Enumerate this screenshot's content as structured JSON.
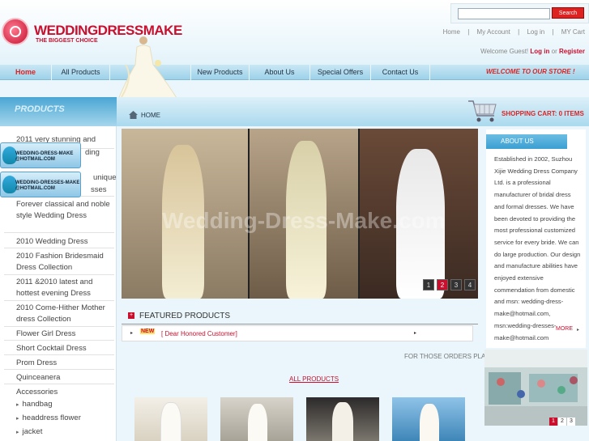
{
  "logo": {
    "name": "WEDDINGDRESSMAKE",
    "tagline": "THE BIGGEST CHOICE"
  },
  "search": {
    "button": "Search",
    "placeholder": ""
  },
  "top_links": [
    "Home",
    "|",
    "My Account",
    "|",
    "Log in",
    "|",
    "MY Cart"
  ],
  "welcome": {
    "prefix": "Welcome Guest!",
    "login": "Log in",
    "or": "or",
    "register": "Register"
  },
  "nav": [
    "Home",
    "All Products",
    "",
    "New Products",
    "About Us",
    "Special Offers",
    "Contact Us"
  ],
  "welcome_store": "WELCOME TO OUR STORE !",
  "sidebar": {
    "title": "PRODUCTS",
    "items": [
      "2011 very stunning and",
      "ding",
      "unique",
      "sses",
      "Forever classical and noble style Wedding Dress",
      "2010 Wedding Dress",
      "2010 Fashion Bridesmaid Dress Collection",
      "2011 &2010 latest and hottest evening Dress",
      "2010 Come-Hither Mother dress Collection",
      "Flower Girl Dress",
      "Short Cocktail Dress",
      "Prom Dress",
      "Quinceanera",
      "Accessories"
    ],
    "sub_items": [
      "handbag",
      "headdress flower",
      "jacket"
    ],
    "msn_badges": [
      "WEDDING-DRESS-MAKE @HOTMAIL.COM",
      "WEDDING-DRESSES-MAKE @HOTMAIL.COM"
    ]
  },
  "breadcrumb": {
    "home": "HOME"
  },
  "cart": {
    "label": "SHOPPING CART: 0 ITEMS"
  },
  "banner": {
    "watermark": "Wedding-Dress-Make.com",
    "pages": [
      "1",
      "2",
      "3",
      "4"
    ],
    "active_page": "2"
  },
  "featured": {
    "title": "FEATURED PRODUCTS",
    "badge": "NEW",
    "ticker": "[ Dear Honored Customer]",
    "orders_text": "FOR THOSE ORDERS PLACE",
    "all_products": "ALL PRODUCTS"
  },
  "about": {
    "title": "ABOUT US",
    "text": "Established in 2002, Suzhou Xijie Wedding Dress Company Ltd. is a professional manufacturer of bridal dress and formal dresses. We have been devoted to providing the most professional customized service for every bride. We can do large production. Our design and manufacture abilities have enjoyed extensive commendation from domestic and msn: wedding-dress-make@hotmail.com, msn:wedding-dresses-make@hotmail.com",
    "more": "MORE"
  },
  "factory_pages": [
    "1",
    "2",
    "3"
  ],
  "colors": {
    "accent": "#c8102e",
    "nav": "#9cd2ea",
    "background": "#eaf6fb"
  }
}
